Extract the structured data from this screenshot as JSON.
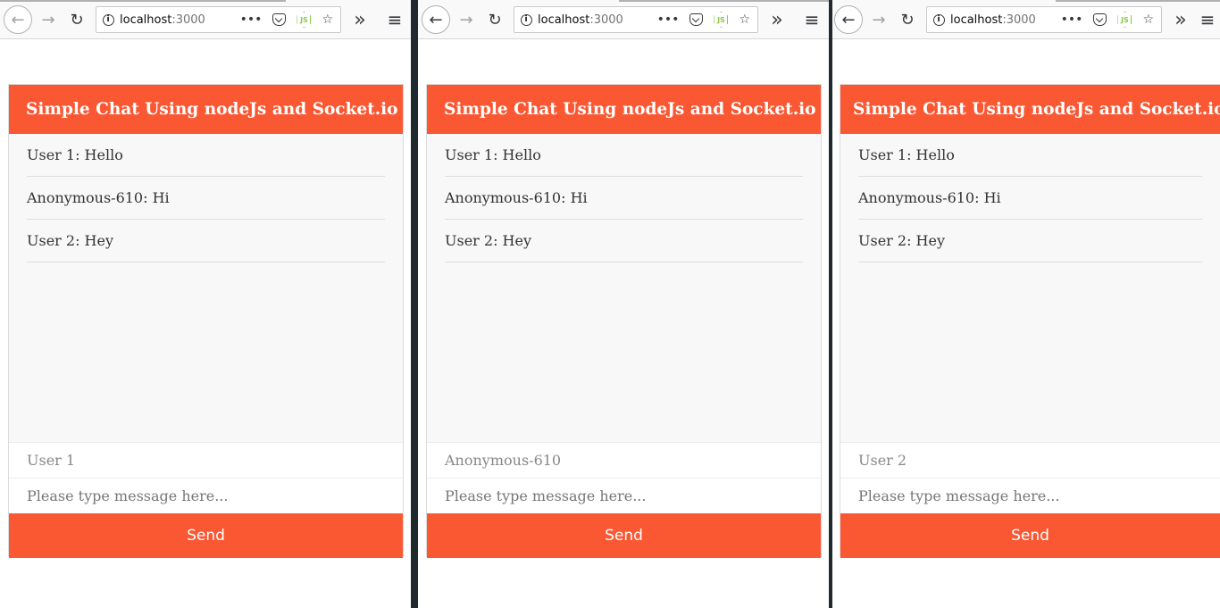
{
  "browser": {
    "url_host": "localhost",
    "url_port": ":3000",
    "more_label": "•••",
    "overflow_label": "»",
    "menu_label": "≡"
  },
  "chat": {
    "title": "Simple Chat Using nodeJs and Socket.io",
    "messages": [
      "User 1: Hello",
      "Anonymous-610: Hi",
      "User 2: Hey"
    ],
    "message_placeholder": "Please type message here...",
    "send_label": "Send"
  },
  "windows": [
    {
      "username": "User 1"
    },
    {
      "username": "Anonymous-610"
    },
    {
      "username": "User 2"
    }
  ],
  "colors": {
    "accent": "#fa5733",
    "chat_bg": "#f8f8f8",
    "nodejs_green": "#8cc84b"
  },
  "icons": [
    "back-arrow-icon",
    "forward-arrow-icon",
    "reload-icon",
    "info-icon",
    "more-actions-icon",
    "pocket-icon",
    "nodejs-icon",
    "bookmark-star-icon",
    "overflow-chevron-icon",
    "hamburger-menu-icon"
  ]
}
